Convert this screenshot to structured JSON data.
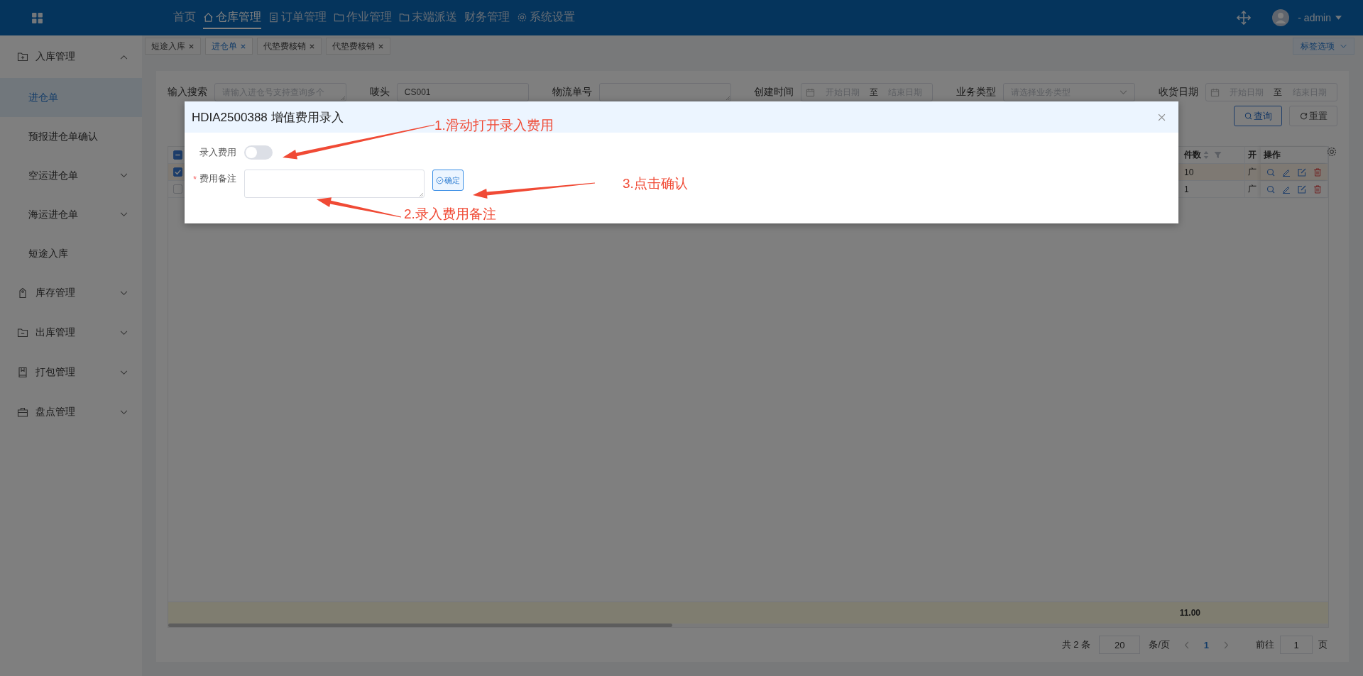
{
  "top_bar": {
    "nav": [
      {
        "label": "首页",
        "selected": false
      },
      {
        "label": "仓库管理",
        "selected": true
      },
      {
        "label": "订单管理",
        "selected": false
      },
      {
        "label": "作业管理",
        "selected": false
      },
      {
        "label": "末端派送",
        "selected": false
      },
      {
        "label": "财务管理",
        "selected": false
      },
      {
        "label": "系统设置",
        "selected": false
      }
    ],
    "user": "- admin"
  },
  "tabs": [
    {
      "label": "短途入库",
      "selected": false
    },
    {
      "label": "进仓单",
      "selected": true
    },
    {
      "label": "代垫费核销",
      "selected": false
    },
    {
      "label": "代垫费核销",
      "selected": false
    }
  ],
  "tab_options": "标签选项",
  "sidebar": {
    "items": [
      {
        "label": "入库管理",
        "expanded": true,
        "children": [
          {
            "label": "进仓单",
            "kind": "link",
            "selected": true
          },
          {
            "label": "预报进仓单确认",
            "kind": "link",
            "selected": false
          },
          {
            "label": "空运进仓单",
            "kind": "group",
            "selected": false
          },
          {
            "label": "海运进仓单",
            "kind": "group",
            "selected": false
          },
          {
            "label": "短途入库",
            "kind": "link",
            "selected": false
          }
        ]
      },
      {
        "label": "库存管理",
        "expanded": false
      },
      {
        "label": "出库管理",
        "expanded": false
      },
      {
        "label": "打包管理",
        "expanded": false
      },
      {
        "label": "盘点管理",
        "expanded": false
      }
    ]
  },
  "filters": [
    {
      "label": "输入搜索",
      "kind": "textarea",
      "placeholder": "请输入进仓号支持查询多个"
    },
    {
      "label": "唛头",
      "kind": "input",
      "value": "CS001"
    },
    {
      "label": "物流单号",
      "kind": "textarea"
    },
    {
      "label": "创建时间",
      "kind": "daterange",
      "start_placeholder": "开始日期",
      "separator": "至",
      "end_placeholder": "结束日期"
    },
    {
      "label": "业务类型",
      "kind": "select",
      "placeholder": "请选择业务类型"
    },
    {
      "label": "收货日期",
      "kind": "daterange",
      "start_placeholder": "开始日期",
      "separator": "至",
      "end_placeholder": "结束日期"
    }
  ],
  "actions": [
    {
      "label": "查询",
      "kind": "search"
    },
    {
      "label": "重置",
      "kind": "reset"
    }
  ],
  "table": {
    "select_all_partial": true,
    "columns": [
      {
        "label": "件数",
        "sortable": true,
        "filterable": true
      },
      {
        "label": "开"
      },
      {
        "label": "操作"
      }
    ],
    "rows": [
      {
        "selected": true,
        "cells": [
          "10",
          "广"
        ]
      },
      {
        "selected": false,
        "cells": [
          "1",
          "广"
        ]
      }
    ],
    "summary": "11.00"
  },
  "pagination": {
    "total": "共 2 条",
    "page_size": "20",
    "per_page_suffix": "条/页",
    "pages": [
      {
        "label": "1",
        "selected": true
      }
    ],
    "goto_label": "前往",
    "goto_value": "1",
    "goto_suffix": "页"
  },
  "dialog": {
    "title": "HDIA2500388 增值费用录入",
    "fields": [
      {
        "label": "录入费用",
        "kind": "switch",
        "on": false
      },
      {
        "label": "费用备注",
        "kind": "textarea",
        "required_mark": "*"
      }
    ],
    "confirm": "确定"
  },
  "annotations": [
    {
      "text": "1.滑动打开录入费用"
    },
    {
      "text": "2.录入费用备注"
    },
    {
      "text": "3.点击确认"
    }
  ]
}
